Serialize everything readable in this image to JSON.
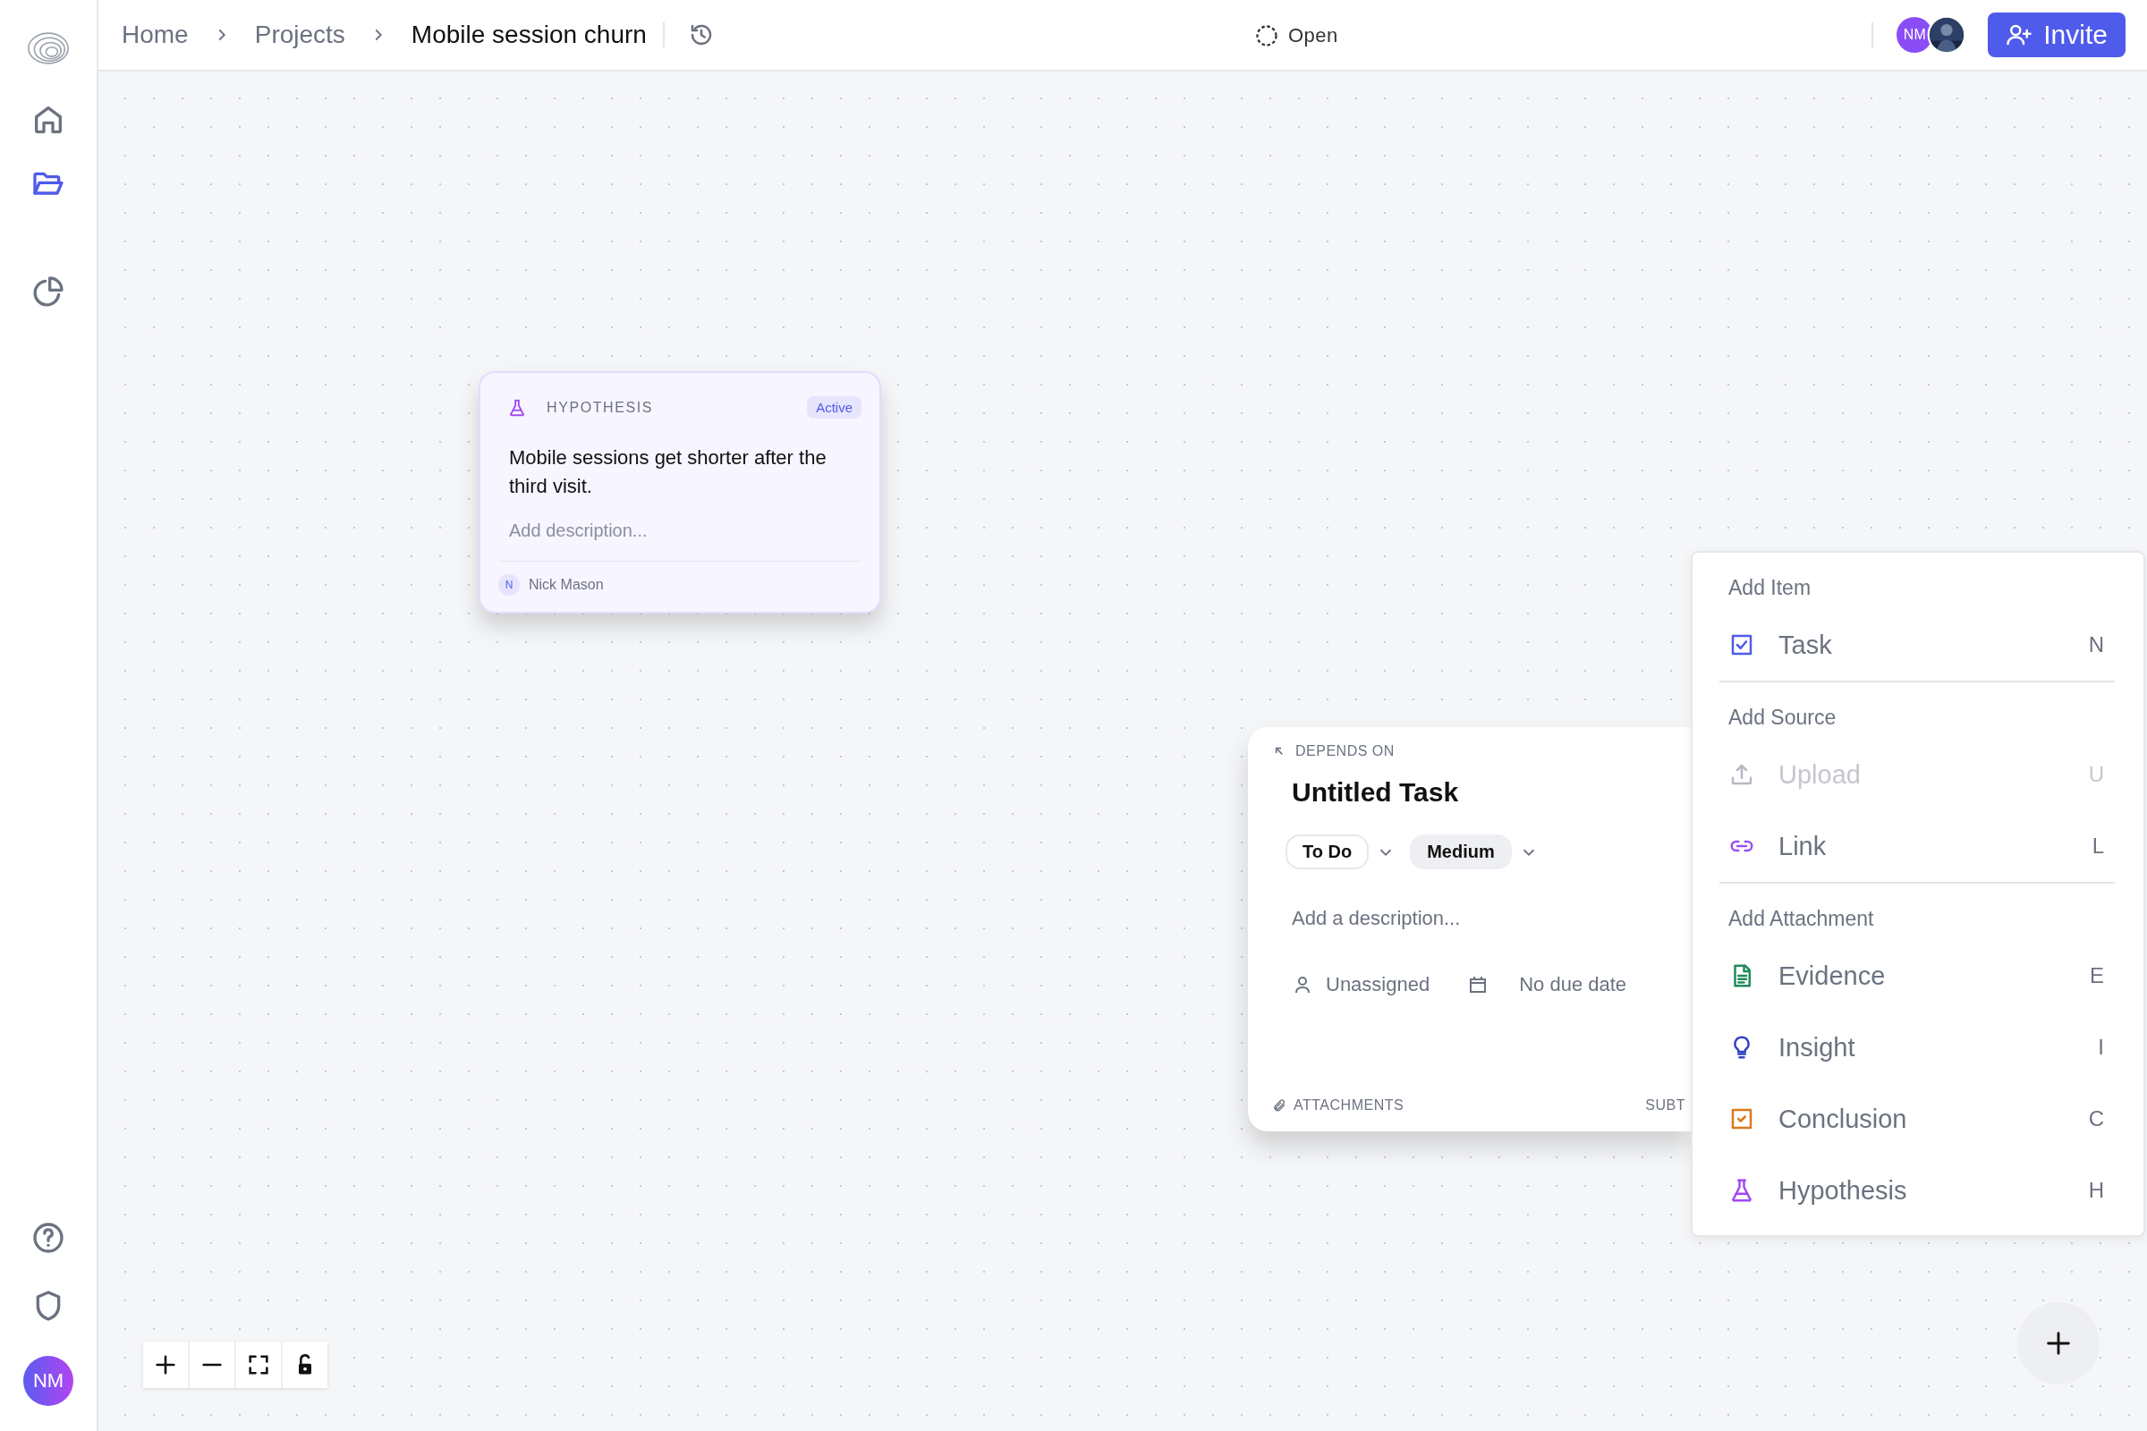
{
  "sidebar": {
    "nav": [
      {
        "kind": "home",
        "selected": false
      },
      {
        "kind": "folder",
        "selected": true
      },
      {
        "kind": "chart",
        "selected": false
      }
    ],
    "bottom": [
      {
        "kind": "help"
      },
      {
        "kind": "shield"
      }
    ],
    "user_initials": "NM"
  },
  "topbar": {
    "breadcrumbs": [
      "Home",
      "Projects",
      "Mobile session churn"
    ],
    "status": "Open",
    "avatars": [
      {
        "kind": "initials",
        "initials": "NM"
      },
      {
        "kind": "picture"
      }
    ],
    "invite_button": "Invite"
  },
  "hypothesis_card": {
    "type_label": "HYPOTHESIS",
    "badge": "Active",
    "title": "Mobile sessions get shorter after the third visit.",
    "description_placeholder": "Add description...",
    "owner_initial": "N",
    "owner": "Nick Mason"
  },
  "task_card": {
    "relation": "DEPENDS ON",
    "title": "Untitled Task",
    "status": "To Do",
    "priority": "Medium",
    "description_placeholder": "Add a description...",
    "assignee": "Unassigned",
    "due_date": "No due date",
    "footer": [
      "ATTACHMENTS",
      "SUBT"
    ]
  },
  "add_menu": {
    "sections": [
      {
        "heading": "Add Item",
        "items": [
          {
            "kind": "task",
            "label": "Task",
            "shortcut": "N",
            "disabled": false
          }
        ]
      },
      {
        "heading": "Add Source",
        "items": [
          {
            "kind": "upload",
            "label": "Upload",
            "shortcut": "U",
            "disabled": true
          },
          {
            "kind": "link",
            "label": "Link",
            "shortcut": "L",
            "disabled": false
          }
        ]
      },
      {
        "heading": "Add Attachment",
        "items": [
          {
            "kind": "evidence",
            "label": "Evidence",
            "shortcut": "E",
            "disabled": false
          },
          {
            "kind": "insight",
            "label": "Insight",
            "shortcut": "I",
            "disabled": false
          },
          {
            "kind": "conclusion",
            "label": "Conclusion",
            "shortcut": "C",
            "disabled": false
          },
          {
            "kind": "hypothesis",
            "label": "Hypothesis",
            "shortcut": "H",
            "disabled": false
          }
        ]
      }
    ]
  },
  "zoom_controls": [
    {
      "kind": "zoom-in"
    },
    {
      "kind": "zoom-out"
    },
    {
      "kind": "fit"
    },
    {
      "kind": "lock"
    }
  ]
}
